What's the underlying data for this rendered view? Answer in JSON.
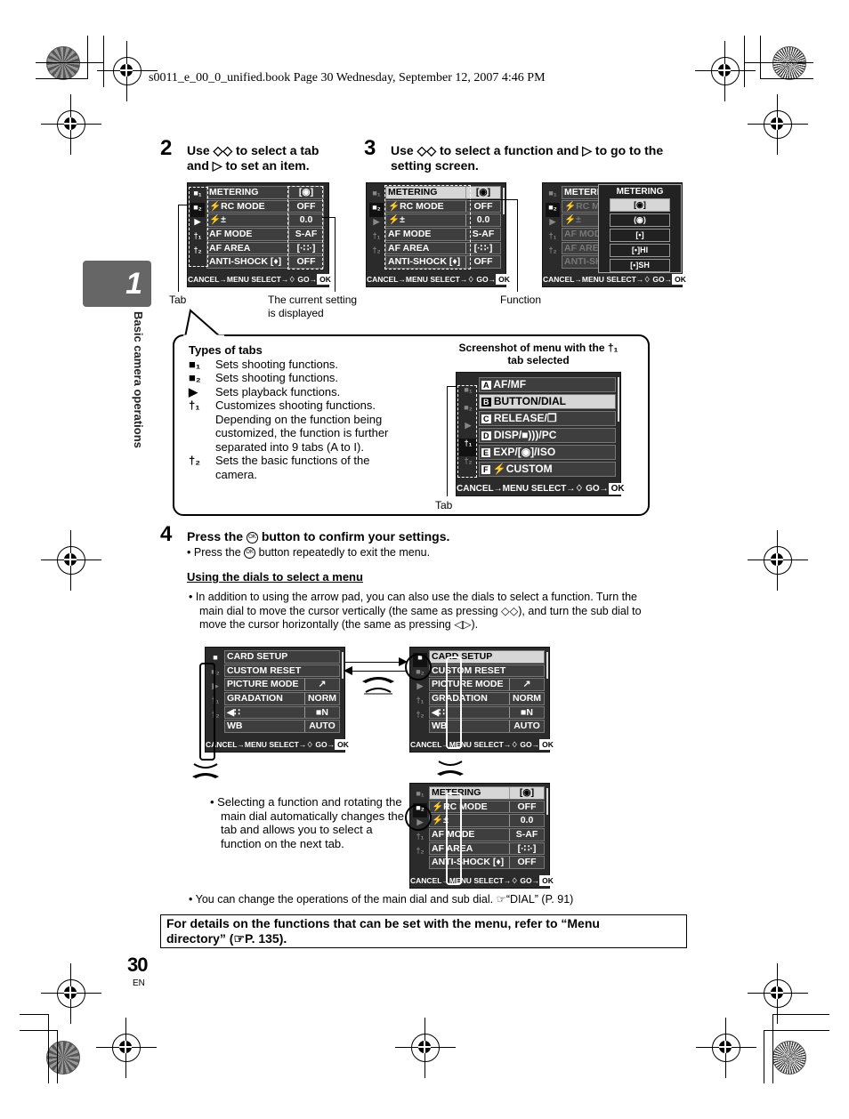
{
  "header": {
    "file_info": "s0011_e_00_0_unified.book  Page 30  Wednesday, September 12, 2007  4:46 PM"
  },
  "chapter": {
    "number": "1",
    "title": "Basic camera operations"
  },
  "step2": {
    "number": "2",
    "line1_pre": "Use ",
    "line1_post": " to select a tab",
    "line2_pre": "and ",
    "line2_post": " to set an item."
  },
  "step3": {
    "number": "3",
    "line1_pre": "Use ",
    "line1_mid": " to select a function and ",
    "line1_post": " to go to the",
    "line2": "setting screen."
  },
  "icons": {
    "updown": "◇◇",
    "right": "▷",
    "ok": "OK",
    "leftright": "◁▷",
    "ref": "☞"
  },
  "screen_main_tabs": [
    "■₁",
    "■₂",
    "▶",
    "†₁",
    "†₂"
  ],
  "screen1": {
    "rows": [
      {
        "label": "METERING",
        "value": "[◉]"
      },
      {
        "label": "⚡RC MODE",
        "value": "OFF"
      },
      {
        "label": "⚡±",
        "value": "0.0"
      },
      {
        "label": "AF MODE",
        "value": "S-AF"
      },
      {
        "label": "AF AREA",
        "value": "[·∷·]"
      },
      {
        "label": "ANTI-SHOCK [♦]",
        "value": "OFF"
      }
    ],
    "footer": {
      "cancel": "CANCEL→MENU",
      "select": "SELECT→♢",
      "go": "GO→",
      "ok": "OK"
    }
  },
  "screen3_popup": {
    "title": "METERING",
    "items": [
      "[◉]",
      "(◉)",
      "[•]",
      "[•]HI",
      "[•]SH"
    ]
  },
  "callouts": {
    "tab": "Tab",
    "current_setting": "The current setting is displayed",
    "function": "Function"
  },
  "types_of_tabs": {
    "heading": "Types of tabs",
    "items": [
      {
        "icon": "camera1-tab-icon",
        "glyph": "■₁",
        "text": "Sets shooting functions."
      },
      {
        "icon": "camera2-tab-icon",
        "glyph": "■₂",
        "text": "Sets shooting functions."
      },
      {
        "icon": "playback-tab-icon",
        "glyph": "▶",
        "text": "Sets playback functions."
      },
      {
        "icon": "custom1-tab-icon",
        "glyph": "†₁",
        "text": "Customizes shooting functions. Depending on the function being customized, the function is further separated into 9 tabs (A to I)."
      },
      {
        "icon": "custom2-tab-icon",
        "glyph": "†₂",
        "text": "Sets the basic functions of the camera."
      }
    ]
  },
  "custom_screen": {
    "caption_line1": "Screenshot of menu with the †₁",
    "caption_line2": "tab selected",
    "rows": [
      {
        "badge": "A",
        "label": "AF/MF"
      },
      {
        "badge": "B",
        "label": "BUTTON/DIAL"
      },
      {
        "badge": "C",
        "label": "RELEASE/❐"
      },
      {
        "badge": "D",
        "label": "DISP/■)))/PC"
      },
      {
        "badge": "E",
        "label": "EXP/[◉]/ISO"
      },
      {
        "badge": "F",
        "label": "⚡CUSTOM"
      }
    ],
    "tab_label": "Tab"
  },
  "step4": {
    "number": "4",
    "title_pre": "Press the ",
    "title_post": " button to confirm your settings.",
    "bullet_pre": "Press the ",
    "bullet_post": " button repeatedly to exit the menu."
  },
  "dials_section": {
    "heading": "Using the dials to select a menu",
    "bullet_line1": "In addition to using the arrow pad, you can also use the dials to select a function. Turn the",
    "bullet_line2_pre": "main dial to move the cursor vertically (the same as pressing ",
    "bullet_line2_post": "), and turn the sub dial to",
    "bullet_line3_pre": "move the cursor horizontally (the same as pressing ",
    "bullet_line3_post": ")."
  },
  "screen_setup": {
    "rows": [
      {
        "label": "CARD SETUP",
        "value": ""
      },
      {
        "label": "CUSTOM RESET",
        "value": ""
      },
      {
        "label": "PICTURE MODE",
        "value": "↗"
      },
      {
        "label": "GRADATION",
        "value": "NORM"
      },
      {
        "label": "◀∷",
        "value": "■N"
      },
      {
        "label": "WB",
        "value": "AUTO"
      }
    ]
  },
  "tab_change_note": "Selecting a function and rotating the main dial automatically changes the tab and allows you to select a function on the next tab.",
  "dial_note": {
    "text_pre": "You can change the operations of the main dial and sub dial. ",
    "text_post": "“DIAL” (P. 91)"
  },
  "directory_note": {
    "line1": "For details on the functions that can be set with the menu, refer to “Menu",
    "line2_pre": "directory” (",
    "line2_post": "P. 135)."
  },
  "page": {
    "number": "30",
    "language": "EN"
  }
}
